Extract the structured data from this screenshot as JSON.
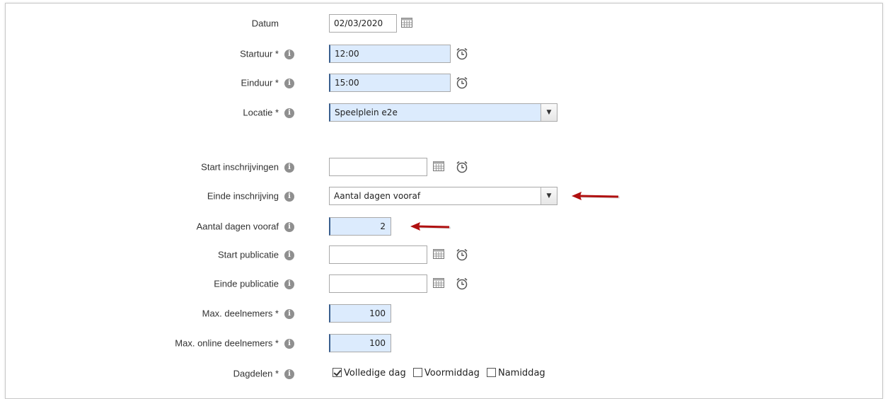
{
  "form": {
    "datum": {
      "label": "Datum",
      "value": "02/03/2020"
    },
    "startuur": {
      "label": "Startuur *",
      "value": "12:00"
    },
    "einduur": {
      "label": "Einduur *",
      "value": "15:00"
    },
    "locatie": {
      "label": "Locatie *",
      "value": "Speelplein e2e"
    },
    "start_inschrijvingen": {
      "label": "Start inschrijvingen",
      "value": ""
    },
    "einde_inschrijving": {
      "label": "Einde inschrijving",
      "value": "Aantal dagen vooraf"
    },
    "aantal_dagen_vooraf": {
      "label": "Aantal dagen vooraf",
      "value": "2"
    },
    "start_publicatie": {
      "label": "Start publicatie",
      "value": ""
    },
    "einde_publicatie": {
      "label": "Einde publicatie",
      "value": ""
    },
    "max_deelnemers": {
      "label": "Max. deelnemers *",
      "value": "100"
    },
    "max_online_deelnemers": {
      "label": "Max. online deelnemers *",
      "value": "100"
    },
    "dagdelen": {
      "label": "Dagdelen *",
      "options": [
        {
          "label": "Volledige dag",
          "checked": true
        },
        {
          "label": "Voormiddag",
          "checked": false
        },
        {
          "label": "Namiddag",
          "checked": false
        }
      ]
    }
  },
  "icons": {
    "info": "info-icon",
    "calendar": "calendar-icon",
    "clock": "alarm-clock-icon",
    "dropdown": "chevron-down-icon",
    "annotation": "red-arrow-icon"
  },
  "colors": {
    "required_field_bg": "#dcebfd",
    "required_field_border": "#3a5f8f",
    "annotation_arrow": "#b01010",
    "info_icon": "#8f8f8f"
  }
}
